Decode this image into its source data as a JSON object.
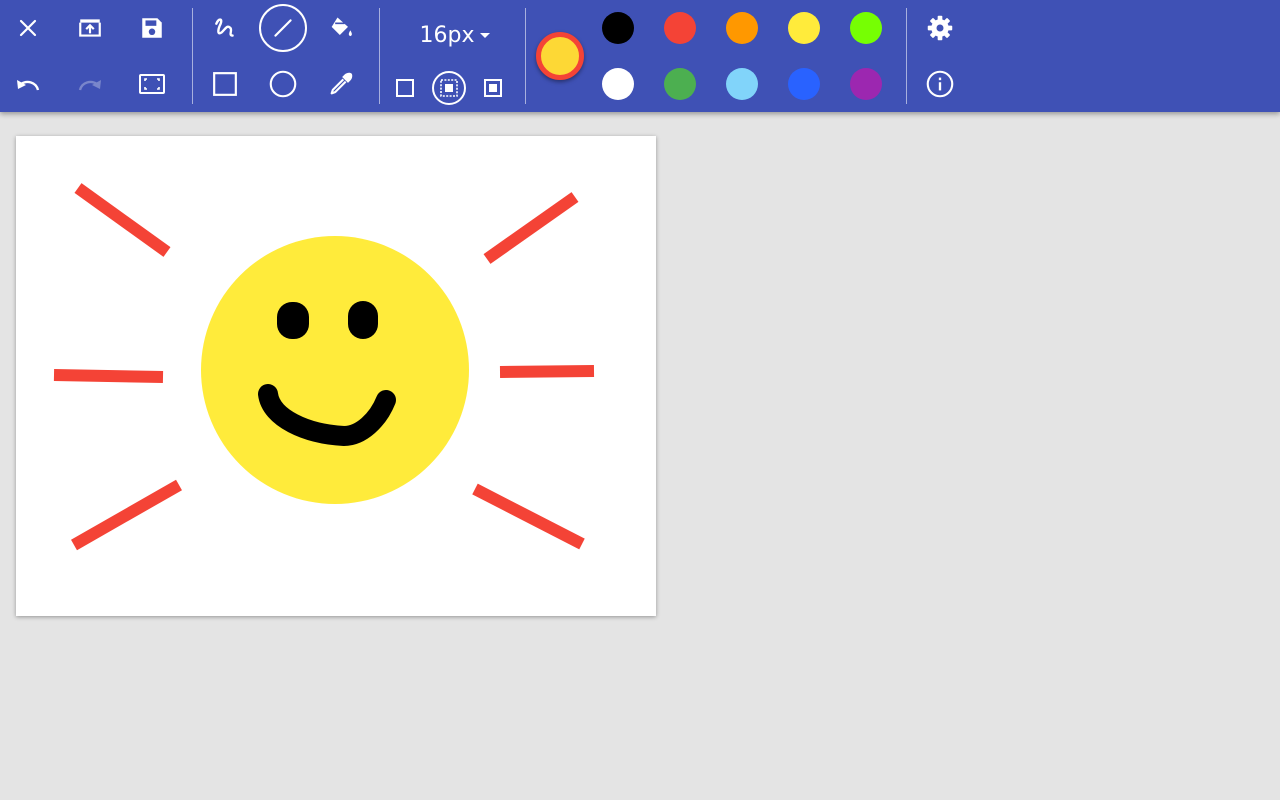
{
  "toolbar": {
    "brush_size": "16px",
    "current_color": "#fdd835",
    "current_color_border": "#f44336",
    "background": "#3f51b5",
    "palette": [
      {
        "name": "black",
        "color": "#000000"
      },
      {
        "name": "red",
        "color": "#f44336"
      },
      {
        "name": "orange",
        "color": "#ff9800"
      },
      {
        "name": "yellow",
        "color": "#ffeb3b"
      },
      {
        "name": "lime",
        "color": "#76ff03"
      },
      {
        "name": "white",
        "color": "#ffffff"
      },
      {
        "name": "green",
        "color": "#4caf50"
      },
      {
        "name": "light-blue",
        "color": "#81d4fa"
      },
      {
        "name": "blue",
        "color": "#2962ff"
      },
      {
        "name": "purple",
        "color": "#9c27b0"
      }
    ],
    "selected_tool": "line",
    "selected_fill": "outline-and-fill"
  },
  "drawing": {
    "sun_color": "#ffeb3b",
    "ray_color": "#f44336",
    "face_color": "#000000"
  }
}
